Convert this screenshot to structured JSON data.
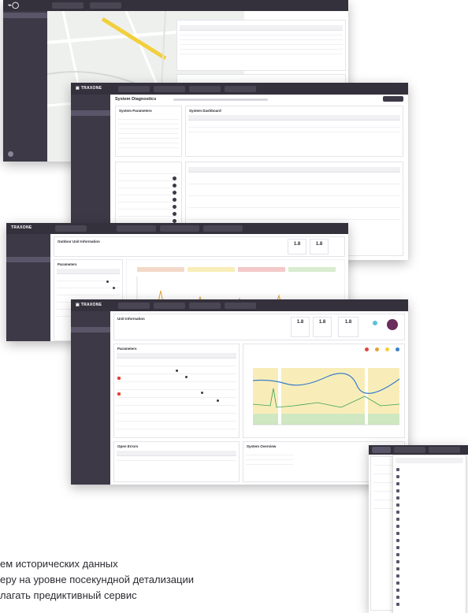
{
  "bullets": [
    "ем исторических данных",
    "еру на уровне посекундной детализации",
    "лагать предиктивный сервис"
  ],
  "screen2": {
    "title": "System Diagnostics",
    "panel_left": "System Parameters",
    "panel_right": "System Dashboard"
  },
  "screen3": {
    "logo": "TRAXONE",
    "title": "Outdoor Unit Information",
    "panel_left": "Parameters",
    "kpi1": "1.8",
    "kpi2": "1.8"
  },
  "screen4": {
    "title": "Unit Information",
    "panel_left": "Parameters",
    "panel_bottom_left": "Open Errors",
    "panel_bottom_right": "System Overview",
    "kpi1": "1.8",
    "kpi2": "1.8",
    "kpi3": "1.8"
  },
  "colors": {
    "sidebar": "#3d3947",
    "topbar": "#34303c",
    "line_blue": "#3a7fc9",
    "line_orange": "#e3a33a",
    "fill_yellow": "#f8edb8",
    "fill_green": "#cfe8c2"
  }
}
